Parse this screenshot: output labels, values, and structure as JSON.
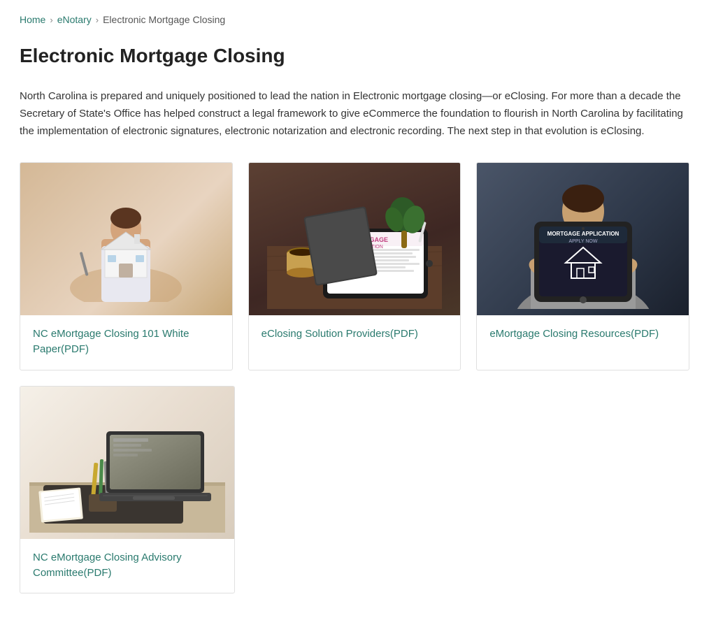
{
  "breadcrumb": {
    "home_label": "Home",
    "home_url": "#",
    "enotary_label": "eNotary",
    "enotary_url": "#",
    "current_label": "Electronic Mortgage Closing"
  },
  "page": {
    "title": "Electronic Mortgage Closing",
    "body_text": "North Carolina is prepared and uniquely positioned to lead the nation in Electronic mortgage closing—or eClosing. For more than a decade the Secretary of State's Office has helped construct a legal framework to give eCommerce the foundation to flourish in North Carolina by facilitating the implementation of electronic signatures, electronic notarization and electronic recording. The next step in that evolution is eClosing."
  },
  "cards": [
    {
      "id": "card-1",
      "link_text": "NC eMortgage Closing 101 White Paper(PDF)",
      "link_url": "#"
    },
    {
      "id": "card-2",
      "link_text": "eClosing Solution Providers(PDF)",
      "link_url": "#"
    },
    {
      "id": "card-3",
      "link_text": "eMortgage Closing Resources(PDF)",
      "link_url": "#"
    },
    {
      "id": "card-4",
      "link_text": "NC eMortgage Closing Advisory Committee(PDF)",
      "link_url": "#"
    }
  ]
}
